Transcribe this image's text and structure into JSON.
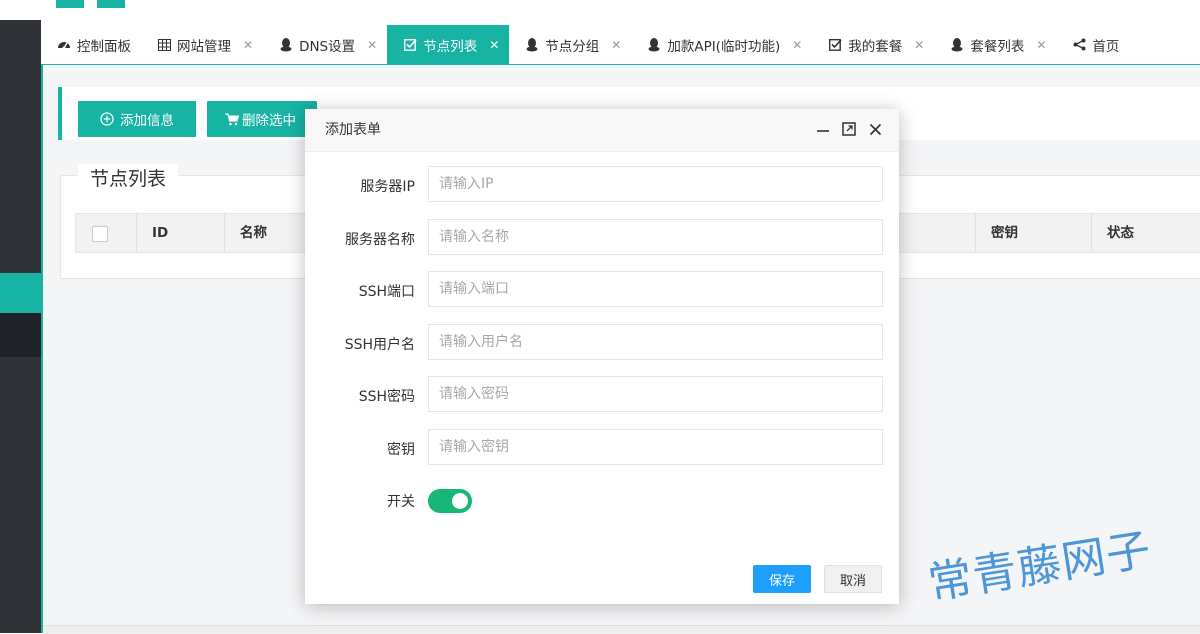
{
  "tabs": [
    {
      "label": "控制面板",
      "icon": "dashboard-icon",
      "closable": false,
      "active": false
    },
    {
      "label": "网站管理",
      "icon": "table-icon",
      "closable": true,
      "active": false
    },
    {
      "label": "DNS设置",
      "icon": "qq-penguin-icon",
      "closable": true,
      "active": false
    },
    {
      "label": "节点列表",
      "icon": "checkbox-icon",
      "closable": true,
      "active": true
    },
    {
      "label": "节点分组",
      "icon": "qq-penguin-icon",
      "closable": true,
      "active": false
    },
    {
      "label": "加款API(临时功能)",
      "icon": "qq-penguin-icon",
      "closable": true,
      "active": false
    },
    {
      "label": "我的套餐",
      "icon": "checkbox-icon",
      "closable": true,
      "active": false
    },
    {
      "label": "套餐列表",
      "icon": "qq-penguin-icon",
      "closable": true,
      "active": false
    },
    {
      "label": "首页",
      "icon": "share-icon",
      "closable": false,
      "active": false
    }
  ],
  "toolbar": {
    "add_label": "添加信息",
    "delete_label": "删除选中"
  },
  "page": {
    "legend": "节点列表"
  },
  "table": {
    "columns": [
      "ID",
      "名称",
      "密钥",
      "状态"
    ]
  },
  "modal": {
    "title": "添加表单",
    "fields": [
      {
        "label": "服务器IP",
        "placeholder": "请输入IP"
      },
      {
        "label": "服务器名称",
        "placeholder": "请输入名称"
      },
      {
        "label": "SSH端口",
        "placeholder": "请输入端口"
      },
      {
        "label": "SSH用户名",
        "placeholder": "请输入用户名"
      },
      {
        "label": "SSH密码",
        "placeholder": "请输入密码"
      },
      {
        "label": "密钥",
        "placeholder": "请输入密钥"
      }
    ],
    "switch_label": "开关",
    "switch_on": true,
    "save_label": "保存",
    "cancel_label": "取消"
  },
  "watermark": "常青藤网子",
  "colors": {
    "accent": "#17b3a3",
    "sidebar": "#2f3338",
    "save_button": "#1e9fff",
    "switch_on": "#16b777",
    "watermark": "#3f8fd6"
  }
}
